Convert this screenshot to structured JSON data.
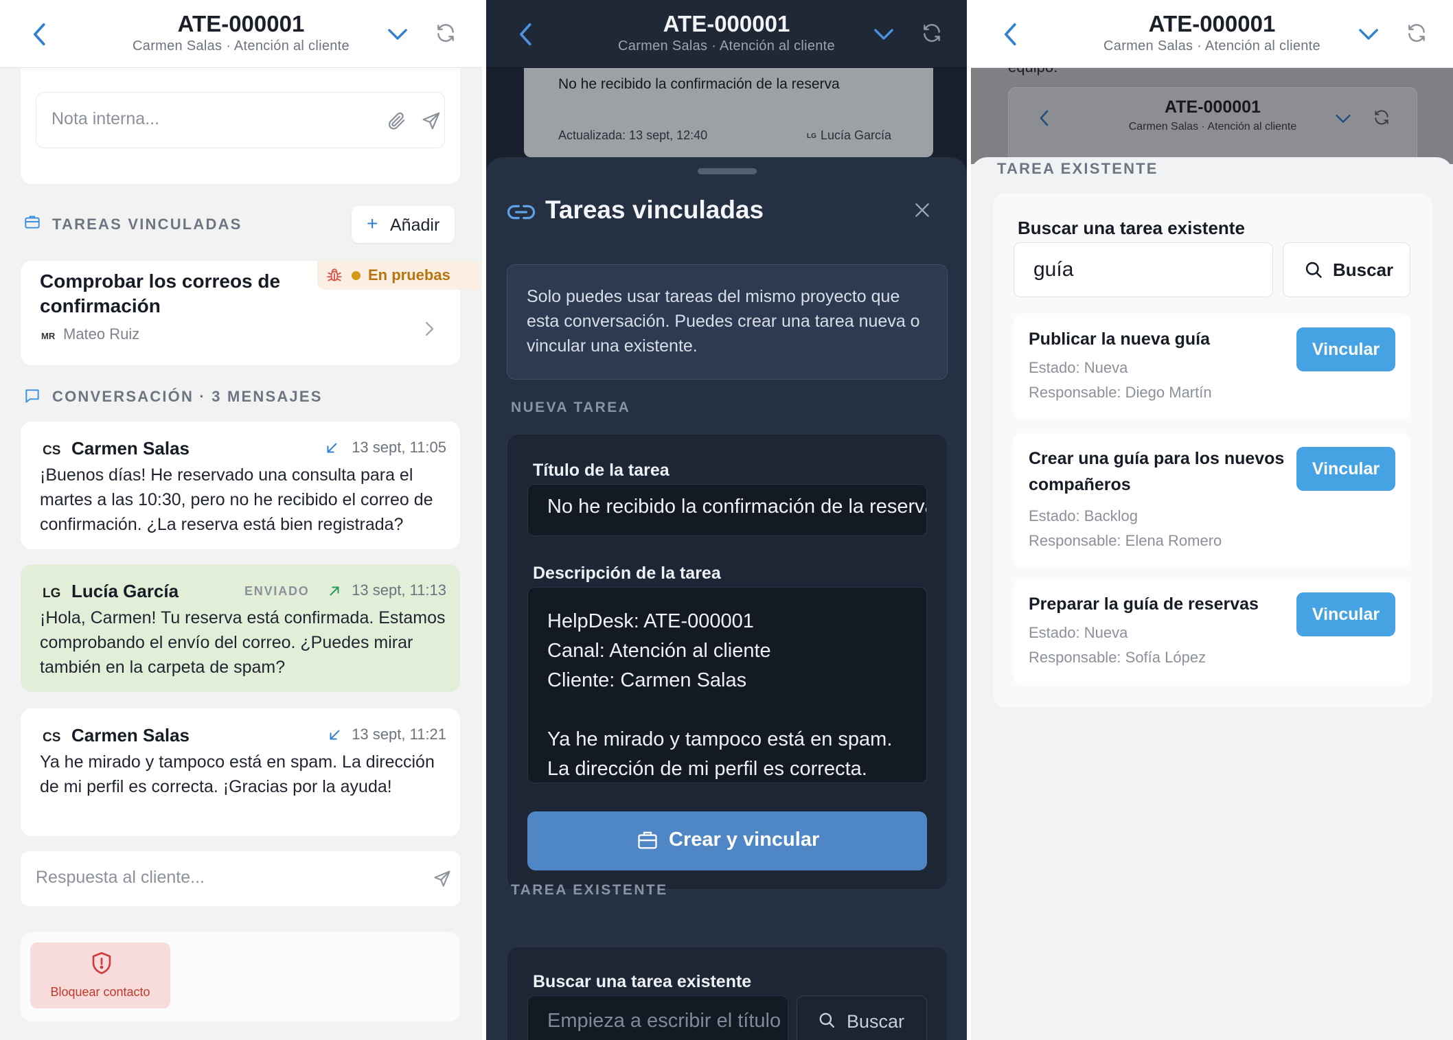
{
  "header": {
    "title": "ATE-000001",
    "subtitle": "Carmen Salas · Atención al cliente"
  },
  "panel1": {
    "note_placeholder": "Nota interna...",
    "linked_tasks_heading": "TAREAS VINCULADAS",
    "add_label": "Añadir",
    "task": {
      "title": "Comprobar los correos de confirmación",
      "status": "En pruebas",
      "assignee_initials": "MR",
      "assignee": "Mateo Ruiz"
    },
    "conversation_heading": "CONVERSACIÓN · 3 MENSAJES",
    "messages": [
      {
        "initials": "CS",
        "author": "Carmen Salas",
        "time": "13 sept, 11:05",
        "sent_label": "",
        "text": "¡Buenos días! He reservado una consulta para el martes a las 10:30, pero no he recibido el correo de confirmación. ¿La reserva está bien registrada?"
      },
      {
        "initials": "LG",
        "author": "Lucía García",
        "time": "13 sept, 11:13",
        "sent_label": "ENVIADO",
        "text": "¡Hola, Carmen! Tu reserva está confirmada. Estamos comprobando el envío del correo. ¿Puedes mirar también en la carpeta de spam?"
      },
      {
        "initials": "CS",
        "author": "Carmen Salas",
        "time": "13 sept, 11:21",
        "sent_label": "",
        "text": "Ya he mirado y tampoco está en spam. La dirección de mi perfil es correcta. ¡Gracias por la ayuda!"
      }
    ],
    "reply_placeholder": "Respuesta al cliente...",
    "block_label": "Bloquear contacto"
  },
  "panel2": {
    "background": {
      "message": "No he recibido la confirmación de la reserva",
      "updated": "Actualizada: 13 sept, 12:40",
      "agent_initials": "LG",
      "agent": "Lucía García"
    },
    "sheet_title": "Tareas vinculadas",
    "info": "Solo puedes usar tareas del mismo proyecto que esta conversación. Puedes crear una tarea nueva o vincular una existente.",
    "new_task_heading": "NUEVA TAREA",
    "title_label": "Título de la tarea",
    "title_value": "No he recibido la confirmación de la reserva",
    "description_label": "Descripción de la tarea",
    "description_value": "HelpDesk: ATE-000001\nCanal: Atención al cliente\nCliente: Carmen Salas\n\nYa he mirado y tampoco está en spam.\nLa dirección de mi perfil es correcta.",
    "create_label": "Crear y vincular",
    "existing_heading": "TAREA EXISTENTE",
    "search_label": "Buscar una tarea existente",
    "search_placeholder": "Empieza a escribir el título",
    "search_button": "Buscar"
  },
  "panel3": {
    "background_fragment": "equipo.",
    "existing_heading": "TAREA EXISTENTE",
    "search_label": "Buscar una tarea existente",
    "search_value": "guía",
    "search_button": "Buscar",
    "results": [
      {
        "title": "Publicar la nueva guía",
        "status": "Estado: Nueva",
        "owner": "Responsable: Diego Martín",
        "action": "Vincular"
      },
      {
        "title": "Crear una guía para los nuevos compañeros",
        "status": "Estado: Backlog",
        "owner": "Responsable: Elena Romero",
        "action": "Vincular"
      },
      {
        "title": "Preparar la guía de reservas",
        "status": "Estado: Nueva",
        "owner": "Responsable: Sofía López",
        "action": "Vincular"
      }
    ]
  },
  "colors": {
    "accent_blue": "#2f80d1",
    "link_button": "#45a2e3",
    "create_button": "#4f86c5",
    "status_testing": "#d29a12",
    "sent_bubble": "#e3eed8",
    "danger": "#c0392b"
  },
  "icons": [
    "back-icon",
    "chevron-down-icon",
    "refresh-icon",
    "paperclip-icon",
    "send-icon",
    "briefcase-icon",
    "plus-icon",
    "bug-icon",
    "chevron-right-icon",
    "chat-icon",
    "incoming-arrow-icon",
    "outgoing-arrow-icon",
    "shield-icon",
    "link-icon",
    "close-icon",
    "search-icon"
  ]
}
